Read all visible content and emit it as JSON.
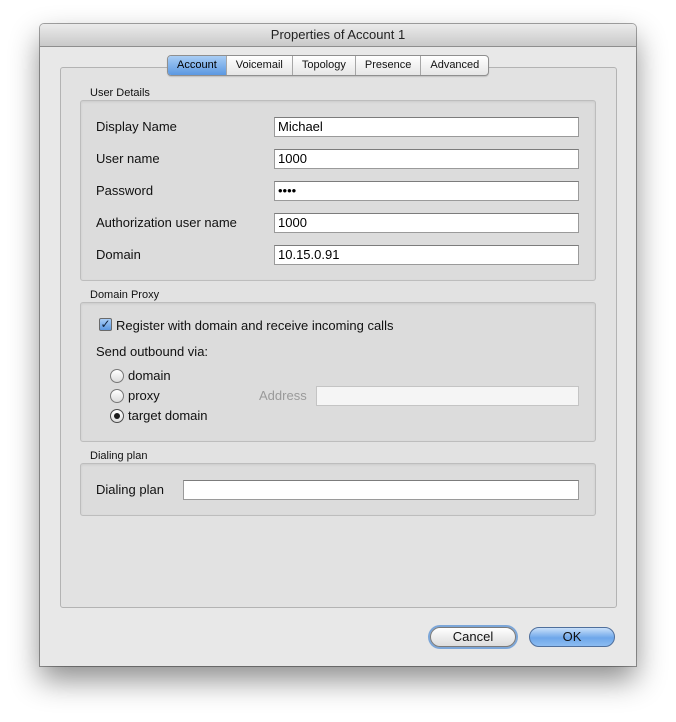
{
  "window": {
    "title": "Properties of Account 1"
  },
  "tabs": [
    {
      "label": "Account",
      "active": true
    },
    {
      "label": "Voicemail",
      "active": false
    },
    {
      "label": "Topology",
      "active": false
    },
    {
      "label": "Presence",
      "active": false
    },
    {
      "label": "Advanced",
      "active": false
    }
  ],
  "user_details": {
    "section_label": "User Details",
    "fields": {
      "display_name": {
        "label": "Display Name",
        "value": "Michael"
      },
      "user_name": {
        "label": "User name",
        "value": "1000"
      },
      "password": {
        "label": "Password",
        "value": "••••"
      },
      "auth_user_name": {
        "label": "Authorization user name",
        "value": "1000"
      },
      "domain": {
        "label": "Domain",
        "value": "10.15.0.91"
      }
    }
  },
  "domain_proxy": {
    "section_label": "Domain Proxy",
    "register_checkbox": {
      "label": "Register with domain and receive incoming calls",
      "checked": true,
      "glyph": "✓"
    },
    "send_outbound_label": "Send outbound via:",
    "options": {
      "domain": "domain",
      "proxy": "proxy",
      "target_domain": "target domain"
    },
    "selected_option": "target domain",
    "address_label": "Address",
    "address_value": ""
  },
  "dialing_plan": {
    "section_label": "Dialing plan",
    "field_label": "Dialing plan",
    "value": ""
  },
  "buttons": {
    "cancel": "Cancel",
    "ok": "OK"
  }
}
